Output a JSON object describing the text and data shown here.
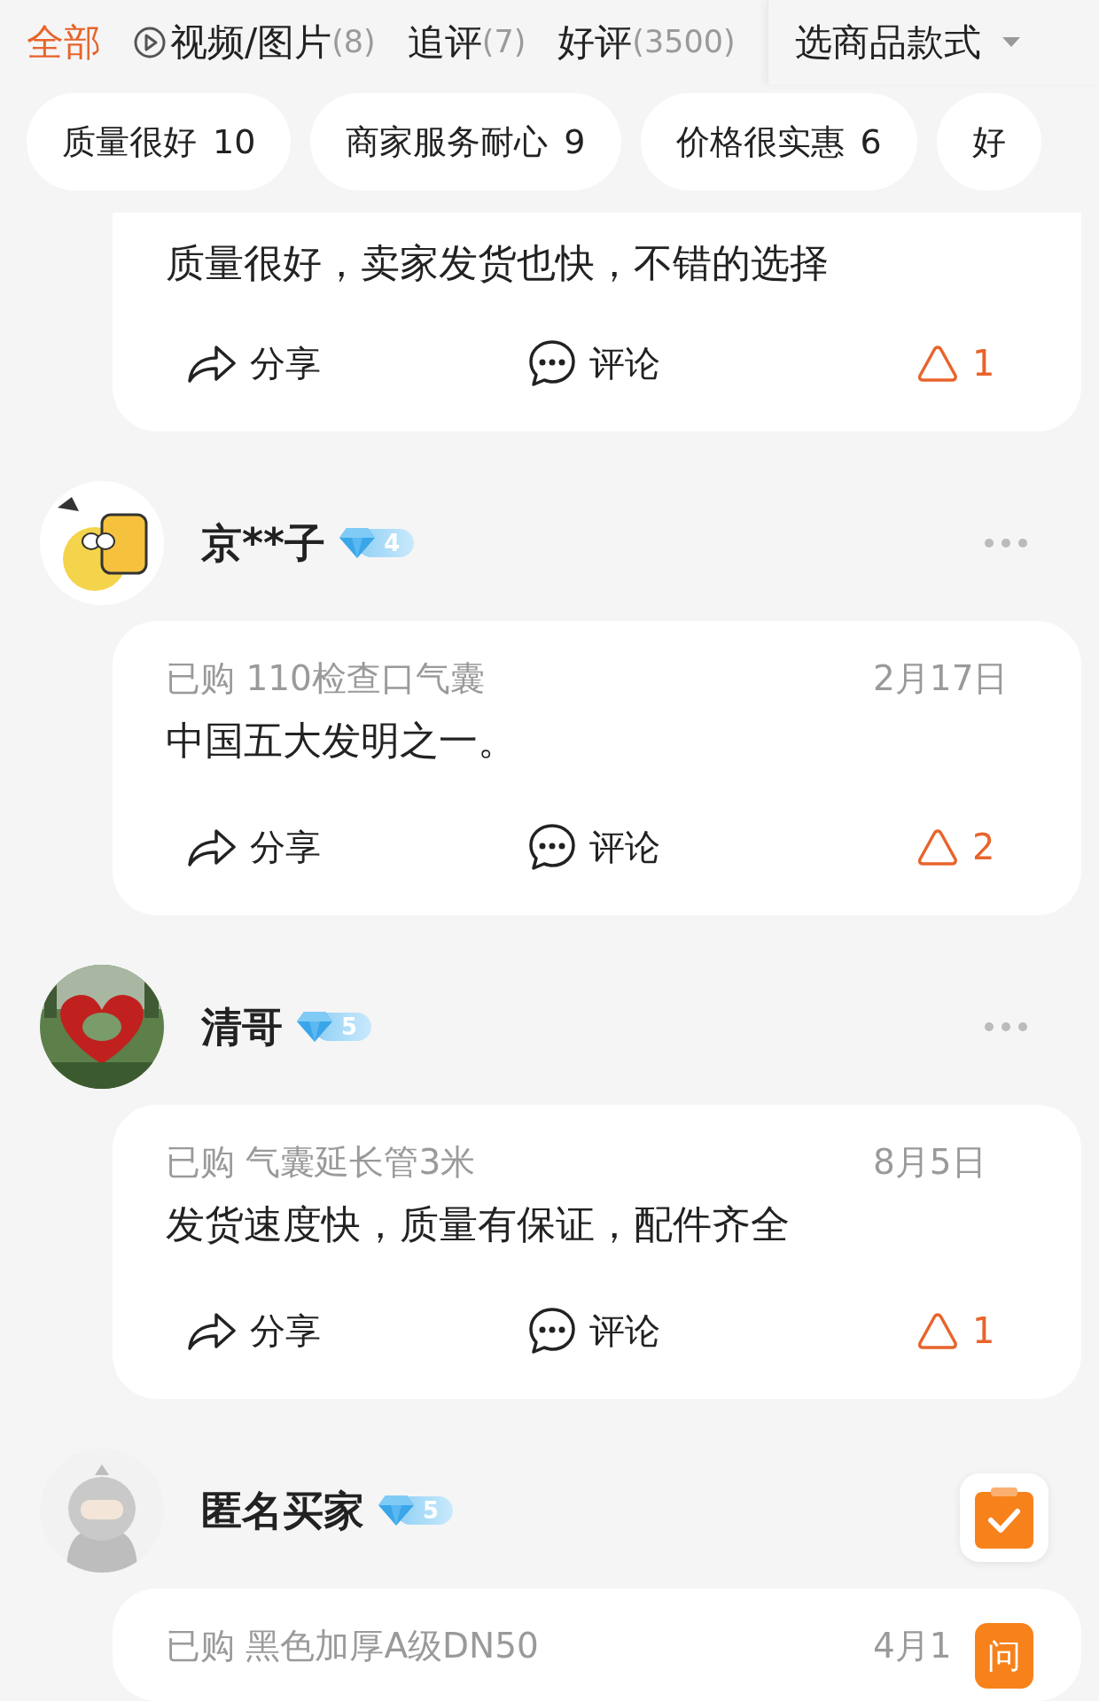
{
  "tabs": [
    {
      "label": "全部",
      "selected": true,
      "kind": "plain"
    },
    {
      "label": "视频/图片",
      "count": "(8)",
      "selected": false,
      "kind": "media"
    },
    {
      "label": "追评",
      "count": "(7)",
      "selected": false,
      "kind": "plain"
    },
    {
      "label": "好评",
      "count": "(3500)",
      "selected": false,
      "kind": "plain"
    }
  ],
  "style_filter": {
    "label": "选商品款式"
  },
  "tags": [
    {
      "label": "质量很好",
      "count": "10"
    },
    {
      "label": "商家服务耐心",
      "count": "9"
    },
    {
      "label": "价格很实惠",
      "count": "6"
    },
    {
      "label": "好"
    }
  ],
  "reviews": [
    {
      "text": "质量很好，卖家发货也快，不错的选择",
      "actions": {
        "share": "分享",
        "comment": "评论",
        "likes": "1"
      }
    },
    {
      "user": {
        "name": "京**子",
        "level": "4",
        "more_button": true
      },
      "purchased": "已购 110检查口气囊",
      "date": "2月17日",
      "text": "中国五大发明之一。",
      "actions": {
        "share": "分享",
        "comment": "评论",
        "likes": "2"
      }
    },
    {
      "user": {
        "name": "清哥",
        "level": "5",
        "more_button": true
      },
      "purchased": "已购 气囊延长管3米",
      "date": "8月5日",
      "text": "发货速度快，质量有保证，配件齐全",
      "actions": {
        "share": "分享",
        "comment": "评论",
        "likes": "1"
      }
    },
    {
      "user": {
        "name": "匿名买家",
        "level": "5",
        "more_button": false
      },
      "purchased": "已购 黑色加厚A级DN50",
      "date": "4月1"
    }
  ],
  "floating_buttons": [
    {
      "kind": "clipboard"
    },
    {
      "kind": "ask",
      "label": "问"
    }
  ]
}
